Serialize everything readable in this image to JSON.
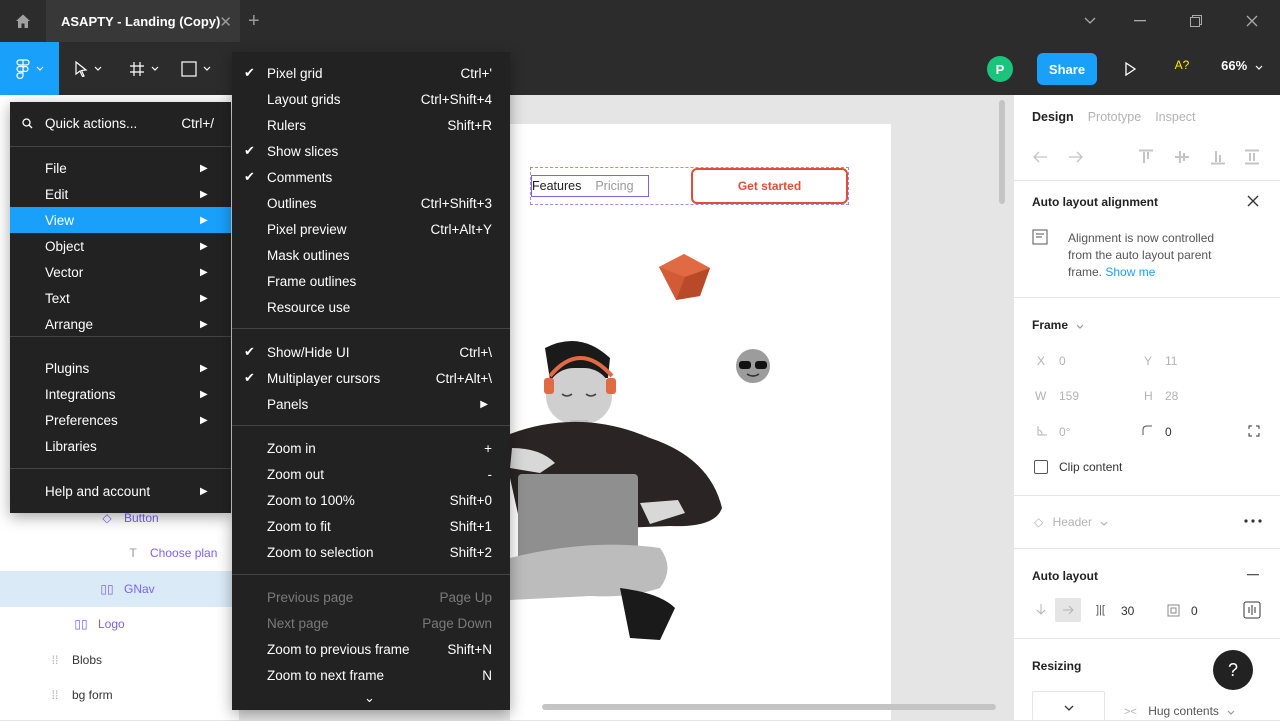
{
  "window": {
    "tab_title": "ASAPTY - Landing (Copy)",
    "tab_close": "✕",
    "new_tab": "+"
  },
  "toolbar": {
    "avatar_initial": "P",
    "share_label": "Share",
    "missing_fonts": "A?",
    "zoom_level": "66%"
  },
  "main_menu": {
    "quick_actions": {
      "label": "Quick actions...",
      "shortcut": "Ctrl+/"
    },
    "items": [
      {
        "label": "File"
      },
      {
        "label": "Edit"
      },
      {
        "label": "View"
      },
      {
        "label": "Object"
      },
      {
        "label": "Vector"
      },
      {
        "label": "Text"
      },
      {
        "label": "Arrange"
      },
      {
        "label": "Plugins"
      },
      {
        "label": "Integrations"
      },
      {
        "label": "Preferences"
      },
      {
        "label": "Libraries"
      },
      {
        "label": "Help and account"
      }
    ],
    "highlighted": "View"
  },
  "view_menu": {
    "items": [
      {
        "label": "Pixel grid",
        "shortcut": "Ctrl+'",
        "checked": true
      },
      {
        "label": "Layout grids",
        "shortcut": "Ctrl+Shift+4",
        "checked": false
      },
      {
        "label": "Rulers",
        "shortcut": "Shift+R",
        "checked": false
      },
      {
        "label": "Show slices",
        "shortcut": "",
        "checked": true
      },
      {
        "label": "Comments",
        "shortcut": "",
        "checked": true
      },
      {
        "label": "Outlines",
        "shortcut": "Ctrl+Shift+3",
        "checked": false
      },
      {
        "label": "Pixel preview",
        "shortcut": "Ctrl+Alt+Y",
        "checked": false
      },
      {
        "label": "Mask outlines",
        "shortcut": "",
        "checked": false
      },
      {
        "label": "Frame outlines",
        "shortcut": "",
        "checked": false
      },
      {
        "label": "Resource use",
        "shortcut": "",
        "checked": false
      },
      {
        "label": "Show/Hide UI",
        "shortcut": "Ctrl+\\",
        "checked": true
      },
      {
        "label": "Multiplayer cursors",
        "shortcut": "Ctrl+Alt+\\",
        "checked": true
      },
      {
        "label": "Panels",
        "shortcut": "",
        "checked": false
      },
      {
        "label": "Zoom in",
        "shortcut": "+",
        "checked": false
      },
      {
        "label": "Zoom out",
        "shortcut": "-",
        "checked": false
      },
      {
        "label": "Zoom to 100%",
        "shortcut": "Shift+0",
        "checked": false
      },
      {
        "label": "Zoom to fit",
        "shortcut": "Shift+1",
        "checked": false
      },
      {
        "label": "Zoom to selection",
        "shortcut": "Shift+2",
        "checked": false
      },
      {
        "label": "Previous page",
        "shortcut": "Page Up",
        "checked": false,
        "disabled": true
      },
      {
        "label": "Next page",
        "shortcut": "Page Down",
        "checked": false,
        "disabled": true
      },
      {
        "label": "Zoom to previous frame",
        "shortcut": "Shift+N",
        "checked": false
      },
      {
        "label": "Zoom to next frame",
        "shortcut": "N",
        "checked": false
      }
    ],
    "more_arrow": "⌄"
  },
  "layers": [
    {
      "label": "Button",
      "icon": "component-icon"
    },
    {
      "label": "Choose plan",
      "icon": "text-icon"
    },
    {
      "label": "GNav",
      "icon": "auto-layout-icon",
      "selected": true
    },
    {
      "label": "Logo",
      "icon": "auto-layout-icon"
    },
    {
      "label": "Blobs",
      "icon": "frame-icon"
    },
    {
      "label": "bg form",
      "icon": "frame-icon"
    }
  ],
  "canvas": {
    "nav_features": "Features",
    "nav_pricing": "Pricing",
    "cta_label": "Get started"
  },
  "design_panel": {
    "tabs": [
      "Design",
      "Prototype",
      "Inspect"
    ],
    "auto_layout_alignment_title": "Auto layout alignment",
    "alignment_note_1": "Alignment is now controlled",
    "alignment_note_2": "from the auto layout parent",
    "alignment_note_3": "frame.",
    "show_me": "Show me",
    "frame_label": "Frame",
    "x_label": "X",
    "x_value": "0",
    "y_label": "Y",
    "y_value": "11",
    "w_label": "W",
    "w_value": "159",
    "h_label": "H",
    "h_value": "28",
    "rotation_value": "0°",
    "radius_value": "0",
    "clip_content": "Clip content",
    "component_name": "Header",
    "auto_layout_title": "Auto layout",
    "spacing_value": "30",
    "padding_value": "0",
    "resizing_title": "Resizing",
    "hug_contents": "Hug contents",
    "help": "?"
  },
  "colors": {
    "accent": "#18a0fb",
    "menu_bg": "#222222",
    "cta": "#e04e39",
    "selection": "#7b61ff"
  }
}
